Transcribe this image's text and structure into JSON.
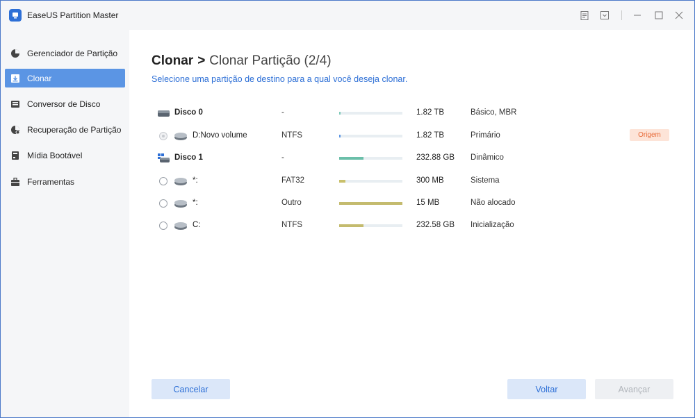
{
  "app": {
    "title": "EaseUS Partition Master"
  },
  "window_controls": {
    "icons": [
      "notes-icon",
      "dropdown-icon",
      "minimize-icon",
      "maximize-icon",
      "close-icon"
    ]
  },
  "sidebar": {
    "items": [
      {
        "label": "Gerenciador de Partição",
        "icon": "pie-chart-icon",
        "active": false
      },
      {
        "label": "Clonar",
        "icon": "clone-icon",
        "active": true
      },
      {
        "label": "Conversor de Disco",
        "icon": "disk-convert-icon",
        "active": false
      },
      {
        "label": "Recuperação de Partição",
        "icon": "recovery-icon",
        "active": false
      },
      {
        "label": "Mídia Bootável",
        "icon": "bootable-media-icon",
        "active": false
      },
      {
        "label": "Ferramentas",
        "icon": "toolbox-icon",
        "active": false
      }
    ]
  },
  "main": {
    "breadcrumb_main": "Clonar",
    "breadcrumb_sep": ">",
    "breadcrumb_sub": "Clonar Partição (2/4)",
    "subtitle": "Selecione uma partição de destino para a qual você deseja clonar.",
    "rows": [
      {
        "kind": "disk",
        "name": "Disco 0",
        "fs": "-",
        "usage": 0.02,
        "bar_color": "#7ec9b8",
        "size": "1.82 TB",
        "type": "Básico, MBR"
      },
      {
        "kind": "partition",
        "name": "D:Novo volume",
        "fs": "NTFS",
        "usage": 0.01,
        "bar_color": "#5b95e4",
        "size": "1.82 TB",
        "type": "Primário",
        "disabled": true,
        "badge": "Origem"
      },
      {
        "kind": "dynamic-disk",
        "name": "Disco 1",
        "fs": "-",
        "usage": 0.38,
        "bar_color": "#6bbfa9",
        "size": "232.88 GB",
        "type": "Dinâmico"
      },
      {
        "kind": "partition",
        "name": "*:",
        "fs": "FAT32",
        "usage": 0.1,
        "bar_color": "#c9c06b",
        "size": "300 MB",
        "type": "Sistema"
      },
      {
        "kind": "partition",
        "name": "*:",
        "fs": "Outro",
        "usage": 1.0,
        "bar_color": "#c4bb6e",
        "size": "15 MB",
        "type": "Não alocado"
      },
      {
        "kind": "partition",
        "name": "C:",
        "fs": "NTFS",
        "usage": 0.38,
        "bar_color": "#c4bb6e",
        "size": "232.58 GB",
        "type": "Inicialização"
      }
    ]
  },
  "footer": {
    "cancel_label": "Cancelar",
    "back_label": "Voltar",
    "next_label": "Avançar"
  }
}
